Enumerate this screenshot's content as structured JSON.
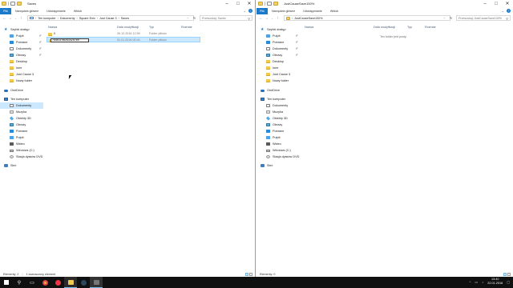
{
  "left_window": {
    "title": "Saves",
    "tabs": [
      {
        "label": "Plik"
      },
      {
        "label": "Narzędzia główne"
      },
      {
        "label": "Udostępnianie"
      },
      {
        "label": "Widok"
      }
    ],
    "breadcrumb": [
      "Ten komputer",
      "Dokumenty",
      "Square Enix",
      "Just Cause 3",
      "Saves"
    ],
    "search_placeholder": "Przeszukaj: Saves",
    "columns": {
      "name": "Nazwa",
      "date": "Data modyfikacji",
      "type": "Typ",
      "size": "Rozmiar"
    },
    "files": [
      {
        "name": "0",
        "date": "26.12.2016 12:59",
        "type": "Folder plików"
      },
      {
        "name": "76561198263425769",
        "date": "01.01.2016 00:44",
        "type": "Folder plików",
        "renaming": true
      }
    ],
    "status": {
      "count": "Elementy: 2",
      "selected": "1 zaznaczony element"
    }
  },
  "right_window": {
    "title": "JustCauseSave100%",
    "tabs": [
      {
        "label": "Plik"
      },
      {
        "label": "Narzędzia główne"
      },
      {
        "label": "Udostępnianie"
      },
      {
        "label": "Widok"
      }
    ],
    "breadcrumb": [
      "JustCauseSave100%"
    ],
    "search_placeholder": "Przeszukaj: JustCauseSave100%",
    "columns": {
      "name": "Nazwa",
      "date": "Data modyfikacji",
      "type": "Typ",
      "size": "Rozmiar"
    },
    "empty_message": "Ten folder jest pusty.",
    "status": {
      "count": "Elementy: 0"
    }
  },
  "nav_pane": {
    "quick_access": "Szybki dostęp",
    "items": [
      {
        "label": "Pulpit",
        "icon": "desktop-icon",
        "pinned": true
      },
      {
        "label": "Pobrane",
        "icon": "download-icon",
        "pinned": true
      },
      {
        "label": "Dokumenty",
        "icon": "documents-icon",
        "pinned": true
      },
      {
        "label": "Obrazy",
        "icon": "pictures-icon",
        "pinned": true
      },
      {
        "label": "Desktop",
        "icon": "folder-icon"
      },
      {
        "label": "Inne",
        "icon": "folder-icon"
      },
      {
        "label": "Just Cause 3",
        "icon": "folder-icon"
      },
      {
        "label": "Nowy folder",
        "icon": "folder-icon"
      }
    ],
    "onedrive": "OneDrive",
    "this_pc": "Ten komputer",
    "pc_items": [
      {
        "label": "Dokumenty",
        "icon": "documents-icon"
      },
      {
        "label": "Muzyka",
        "icon": "music-icon"
      },
      {
        "label": "Obiekty 3D",
        "icon": "3d-objects-icon"
      },
      {
        "label": "Obrazy",
        "icon": "pictures-icon"
      },
      {
        "label": "Pobrane",
        "icon": "download-icon"
      },
      {
        "label": "Pulpit",
        "icon": "desktop-icon"
      },
      {
        "label": "Wideo",
        "icon": "video-icon"
      },
      {
        "label": "Windows (C:)",
        "icon": "drive-icon"
      },
      {
        "label": "Stacja dysków DVD",
        "icon": "dvd-icon"
      }
    ],
    "network": "Sieć"
  },
  "taskbar": {
    "time": "13:40",
    "date": "22.01.2016",
    "tray_chevron": "^"
  },
  "colors": {
    "accent": "#1979ca",
    "selection": "#cce8ff",
    "taskbar": "#101010"
  }
}
